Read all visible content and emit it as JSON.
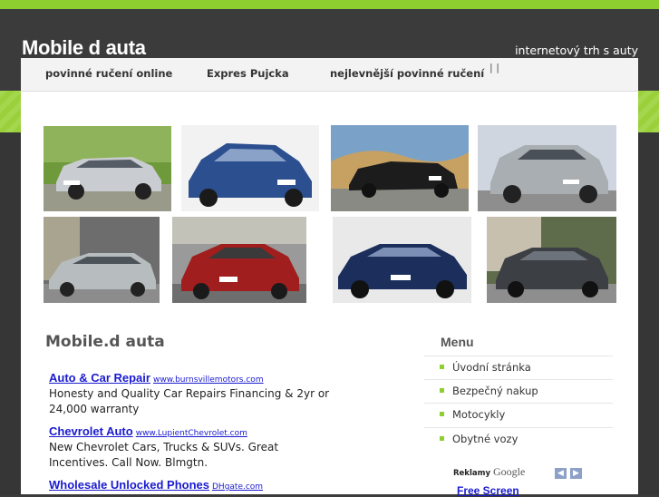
{
  "header": {
    "site_title": "Mobile d auta",
    "tagline": "internetový trh s auty"
  },
  "nav": {
    "items": [
      "povinné ručení online",
      "Expres Pujcka",
      "nejlevnější povinné ručení"
    ],
    "separator": "| |"
  },
  "gallery": {
    "photos": [
      {
        "car_color": "#c9ccd0",
        "bg": "#6f9a3c"
      },
      {
        "car_color": "#2c4f8f",
        "bg": "#f2f2f2"
      },
      {
        "car_color": "#1c1c1c",
        "bg": "#c7a162"
      },
      {
        "car_color": "#a9aeb3",
        "bg": "#cfd6e0"
      },
      {
        "car_color": "#b7bcbf",
        "bg": "#6d6d6d"
      },
      {
        "car_color": "#a01e1e",
        "bg": "#9a9a9a"
      },
      {
        "car_color": "#1b2e5c",
        "bg": "#e9e9e9"
      },
      {
        "car_color": "#3c3f44",
        "bg": "#5f6c4c"
      }
    ]
  },
  "main": {
    "title": "Mobile.d auta",
    "ads": [
      {
        "title": "Auto & Car Repair",
        "url": "www.burnsvillemotors.com",
        "text": "Honesty and Quality Car Repairs Financing & 2yr or 24,000 warranty"
      },
      {
        "title": "Chevrolet Auto",
        "url": "www.LupientChevrolet.com",
        "text": "New Chevrolet Cars, Trucks & SUVs. Great Incentives. Call Now. Blmgtn."
      },
      {
        "title": "Wholesale Unlocked Phones",
        "url": "DHgate.com",
        "text": ""
      }
    ]
  },
  "sidebar": {
    "title": "Menu",
    "items": [
      "Úvodní stránka",
      "Bezpečný nakup",
      "Motocykly",
      "Obytné vozy"
    ],
    "ads_label": "Reklamy",
    "google_label": "Google",
    "prev_icon": "chevron-left-icon",
    "next_icon": "chevron-right-icon",
    "ad_link": "Free Screen"
  },
  "colors": {
    "accent_green": "#8ccf2e",
    "dark_bg": "#3a3a3a",
    "link_blue": "#1a1ad0"
  }
}
